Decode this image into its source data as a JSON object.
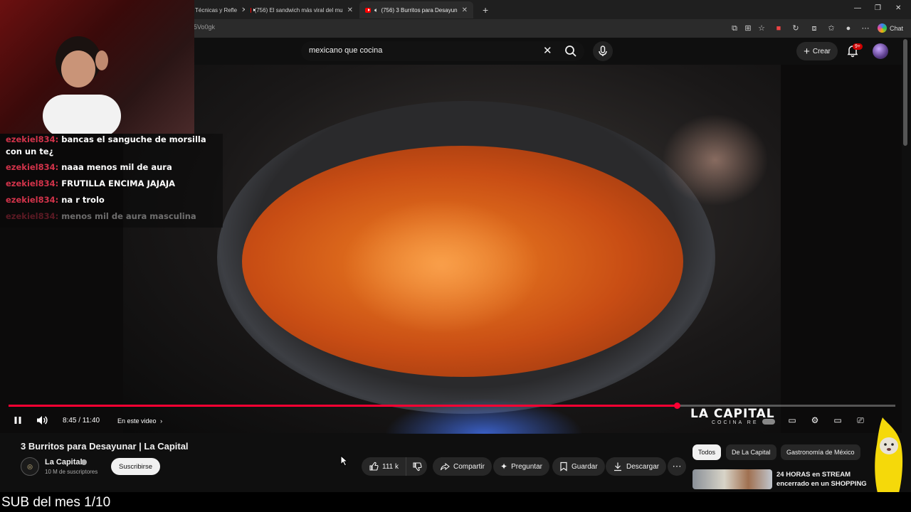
{
  "browser": {
    "tabs": [
      {
        "label": "Técnicas y Refle",
        "active": false
      },
      {
        "label": "(756) El sandwich más viral del mu",
        "active": false
      },
      {
        "label": "(756) 3 Burritos para Desayun",
        "active": true
      }
    ],
    "new_tab": "+",
    "url": "5Vo0gk",
    "chat_label": "Chat"
  },
  "header": {
    "search_value": "mexicano que cocina",
    "create_label": "Crear",
    "notification_count": "9+"
  },
  "stream_chat": [
    {
      "user": "ezekiel834:",
      "message": "bancas el sanguche de morsilla con un te¿"
    },
    {
      "user": "ezekiel834:",
      "message": "naaa menos mil de aura"
    },
    {
      "user": "ezekiel834:",
      "message": "FRUTILLA ENCIMA JAJAJA"
    },
    {
      "user": "ezekiel834:",
      "message": "na r trolo"
    },
    {
      "user": "ezekiel834:",
      "message": "menos mil de aura masculina"
    }
  ],
  "player": {
    "time": "8:45 / 11:40",
    "chapter_label": "En este video",
    "progress": 0.754,
    "watermark": "LA CAPITAL",
    "watermark_sub": "COCINA RE"
  },
  "video": {
    "title": "3 Burritos para Desayunar | La Capital",
    "channel": "La Capital",
    "subscribers": "10 M de suscriptores",
    "subscribe_label": "Suscribirse",
    "likes": "111 k",
    "share_label": "Compartir",
    "ask_label": "Preguntar",
    "save_label": "Guardar",
    "download_label": "Descargar"
  },
  "chips": [
    "Todos",
    "De La Capital",
    "Gastronomía de México"
  ],
  "recommendation": {
    "title": "24 HORAS en STREAM encerrado en un SHOPPING"
  },
  "overlay": {
    "sub_goal": "SUB del mes 1/10"
  },
  "colors": {
    "accent": "#ff0033",
    "chat_user": "#d2334a",
    "background": "#0f0f0f"
  }
}
